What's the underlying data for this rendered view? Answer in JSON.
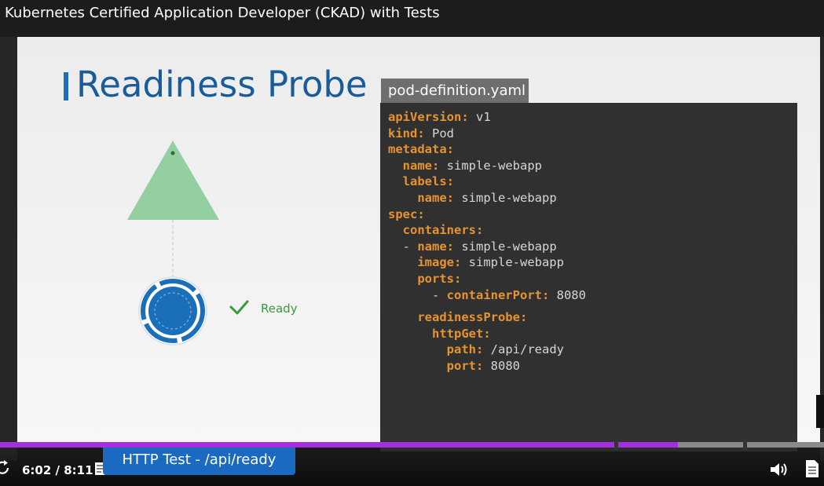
{
  "window": {
    "title": "Kubernetes Certified Application Developer (CKAD) with Tests"
  },
  "slide": {
    "heading": "Readiness Probe",
    "status_label": "Ready",
    "colors": {
      "heading": "#1a5c9a",
      "triangle": "#93cfa0",
      "pod": "#1a6fb8",
      "check": "#3a9a3a"
    }
  },
  "code": {
    "file_tab": "pod-definition.yaml",
    "lines": [
      {
        "indent": "",
        "key": "apiVersion:",
        "value": " v1"
      },
      {
        "indent": "",
        "key": "kind:",
        "value": " Pod"
      },
      {
        "indent": "",
        "key": "metadata:",
        "value": ""
      },
      {
        "indent": "  ",
        "key": "name:",
        "value": " simple-webapp"
      },
      {
        "indent": "  ",
        "key": "labels:",
        "value": ""
      },
      {
        "indent": "    ",
        "key": "name:",
        "value": " simple-webapp"
      },
      {
        "indent": "",
        "key": "spec:",
        "value": ""
      },
      {
        "indent": "  ",
        "key": "containers:",
        "value": ""
      },
      {
        "indent": "  - ",
        "key": "name:",
        "value": " simple-webapp"
      },
      {
        "indent": "    ",
        "key": "image:",
        "value": " simple-webapp"
      },
      {
        "indent": "    ",
        "key": "ports:",
        "value": ""
      },
      {
        "indent": "      - ",
        "key": "containerPort:",
        "value": " 8080"
      },
      {
        "indent": "    ",
        "key": "readinessProbe:",
        "value": ""
      },
      {
        "indent": "      ",
        "key": "httpGet:",
        "value": ""
      },
      {
        "indent": "        ",
        "key": "path:",
        "value": " /api/ready"
      },
      {
        "indent": "        ",
        "key": "port:",
        "value": " 8080"
      }
    ]
  },
  "http_test_tab": "HTTP Test - /api/ready",
  "player": {
    "time": "6:02 / 8:11",
    "progress": 0.823,
    "markers": [
      0.745,
      0.902
    ],
    "icons": {
      "replay": "replay-icon",
      "notes": "notes-icon",
      "volume": "volume-icon",
      "transcript": "transcript-icon"
    }
  }
}
